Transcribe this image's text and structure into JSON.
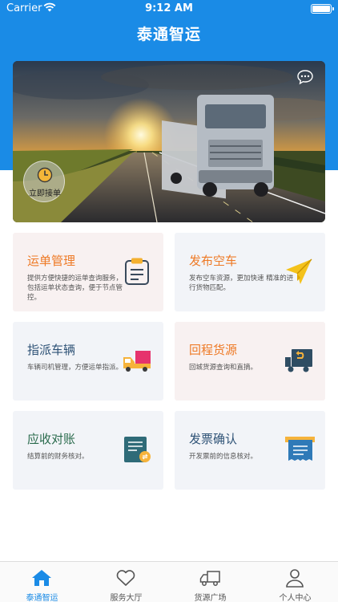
{
  "status_bar": {
    "carrier": "Carrier",
    "time": "9:12 AM"
  },
  "header": {
    "title": "泰通智运"
  },
  "banner": {
    "take_order_label": "立即接单",
    "image": "sunset-truck-on-highway"
  },
  "cards": [
    {
      "title": "运单管理",
      "desc": "提供方便快捷的运单查询服务，包括运单状态查询，便于节点管控。",
      "icon": "clipboard-icon",
      "title_color": "#ee7a26"
    },
    {
      "title": "发布空车",
      "desc": "发布空车资源，更加快速 精准的进行货物匹配。",
      "icon": "paper-plane-icon",
      "title_color": "#ee7a26"
    },
    {
      "title": "指派车辆",
      "desc": "车辆司机管理，方便运单指派。",
      "icon": "delivery-truck-icon",
      "title_color": "#2e5276"
    },
    {
      "title": "回程货源",
      "desc": "回城货源查询和直摘。",
      "icon": "return-truck-icon",
      "title_color": "#ee7a26"
    },
    {
      "title": "应收对账",
      "desc": "结算前的财务核对。",
      "icon": "receivable-document-icon",
      "title_color": "#2a6b4d"
    },
    {
      "title": "发票确认",
      "desc": "开发票前的信息核对。",
      "icon": "invoice-icon",
      "title_color": "#2e5276"
    }
  ],
  "tabs": [
    {
      "label": "泰通智运",
      "icon": "home-icon",
      "active": true
    },
    {
      "label": "服务大厅",
      "icon": "heart-icon",
      "active": false
    },
    {
      "label": "货源广场",
      "icon": "truck-icon",
      "active": false
    },
    {
      "label": "个人中心",
      "icon": "person-icon",
      "active": false
    }
  ],
  "colors": {
    "primary": "#1a8be6",
    "orange": "#ee7a26",
    "navy": "#2e5276",
    "green": "#2a6b4d"
  }
}
